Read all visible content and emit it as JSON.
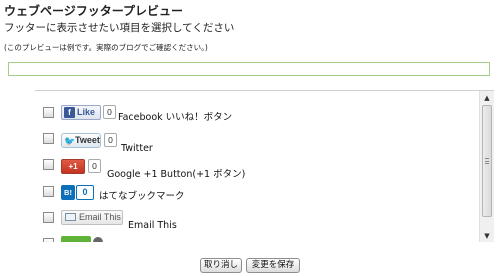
{
  "header": {
    "title": "ウェブページフッタープレビュー",
    "instruction": "フッターに表示させたい項目を選択してください",
    "note": "(このプレビューは例です。実際のブログでご確認ください。)"
  },
  "preview": {
    "value": ""
  },
  "items": [
    {
      "label": "Facebook いいね！ボタン",
      "button_text": "Like",
      "button_icon": "f",
      "count": "0",
      "checked": false
    },
    {
      "label": "Twitter",
      "button_text": "Tweet",
      "button_icon": "twitter-bird",
      "count": "0",
      "checked": false
    },
    {
      "label": "Google +1 Button(+1 ボタン)",
      "button_text": "+1",
      "count": "0",
      "checked": false
    },
    {
      "label": "はてなブックマーク",
      "button_text": "B!",
      "count": "0",
      "checked": false
    },
    {
      "label": "Email This",
      "button_text": "Email This",
      "checked": false
    },
    {
      "label": "",
      "button_text": "",
      "checked": false
    }
  ],
  "footer": {
    "cancel_label": "取り消し",
    "save_label": "変更を保存"
  },
  "scrollbar": {
    "up_arrow": "▲",
    "down_arrow": "▼"
  },
  "colors": {
    "preview_border": "#a6d08a",
    "facebook": "#3b5998",
    "twitter": "#2fa6e0",
    "google_plus": "#d34836",
    "hatena": "#0d6fb8",
    "evernote": "#5fb338"
  }
}
